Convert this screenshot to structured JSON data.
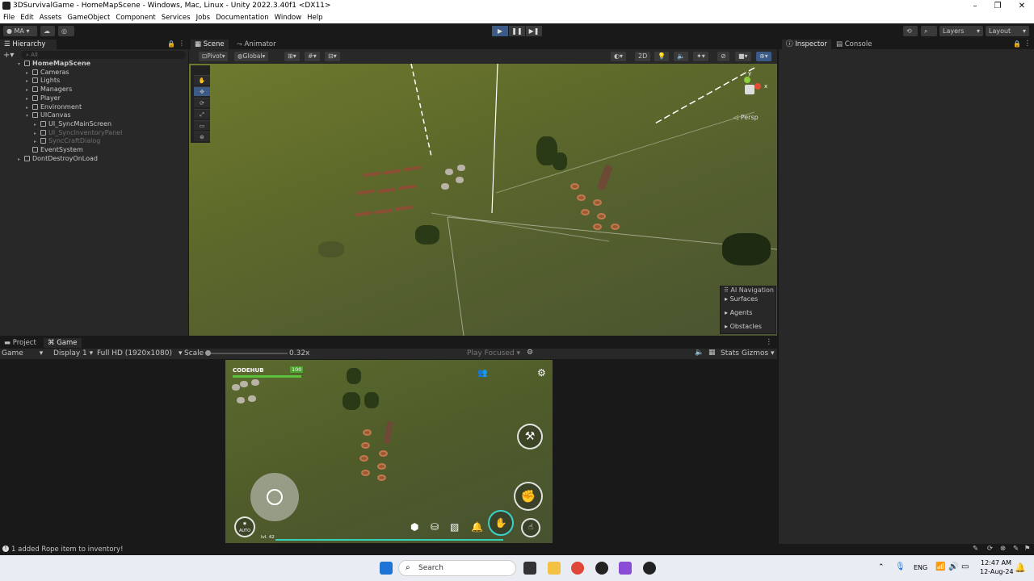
{
  "window": {
    "title": "3DSurvivalGame - HomeMapScene - Windows, Mac, Linux - Unity 2022.3.40f1 <DX11>",
    "controls": [
      "–",
      "❐",
      "✕"
    ]
  },
  "menu": [
    "File",
    "Edit",
    "Assets",
    "GameObject",
    "Component",
    "Services",
    "Jobs",
    "Documentation",
    "Window",
    "Help"
  ],
  "toolbar": {
    "account": "MA",
    "layers": "Layers",
    "layout": "Layout"
  },
  "hierarchy": {
    "tab": "Hierarchy",
    "search_placeholder": "All",
    "items": [
      {
        "label": "HomeMapScene",
        "level": 0,
        "bold": true,
        "dim": false
      },
      {
        "label": "Cameras",
        "level": 1,
        "dim": false
      },
      {
        "label": "Lights",
        "level": 1,
        "dim": false
      },
      {
        "label": "Managers",
        "level": 1,
        "dim": false
      },
      {
        "label": "Player",
        "level": 1,
        "dim": false
      },
      {
        "label": "Environment",
        "level": 1,
        "dim": false
      },
      {
        "label": "UICanvas",
        "level": 1,
        "dim": false
      },
      {
        "label": "UI_SyncMainScreen",
        "level": 2,
        "dim": false
      },
      {
        "label": "UI_SyncInventoryPanel",
        "level": 2,
        "dim": true
      },
      {
        "label": "SyncCraftDialog",
        "level": 2,
        "dim": true
      },
      {
        "label": "EventSystem",
        "level": 1,
        "dim": false
      },
      {
        "label": "DontDestroyOnLoad",
        "level": 0,
        "bold": false,
        "dim": false
      }
    ]
  },
  "scene": {
    "tabs": [
      "Scene",
      "Animator"
    ],
    "pivot": "Pivot",
    "global": "Global",
    "mode2d": "2D",
    "persp": "Persp",
    "gizmo_x": "x",
    "gizmo_y": "y",
    "ai_nav": {
      "title": "AI Navigation",
      "items": [
        "Surfaces",
        "Agents",
        "Obstacles"
      ]
    }
  },
  "right": {
    "tabs": [
      "Inspector",
      "Console"
    ]
  },
  "bottom": {
    "tabs": [
      "Project",
      "Game"
    ],
    "game_mode": "Game",
    "display": "Display 1",
    "resolution": "Full HD (1920x1080)",
    "scale_label": "Scale",
    "scale_value": "0.32x",
    "play_focused": "Play Focused",
    "stats": "Stats",
    "gizmos": "Gizmos"
  },
  "game": {
    "player_name": "CODEHUB",
    "health": "100",
    "auto_label": "AUTO",
    "level_label": "lvl. 42"
  },
  "status": {
    "message": "1 added Rope item to inventory!"
  },
  "taskbar": {
    "search": "Search",
    "lang": "ENG",
    "time": "12:47 AM",
    "date": "12-Aug-24"
  }
}
